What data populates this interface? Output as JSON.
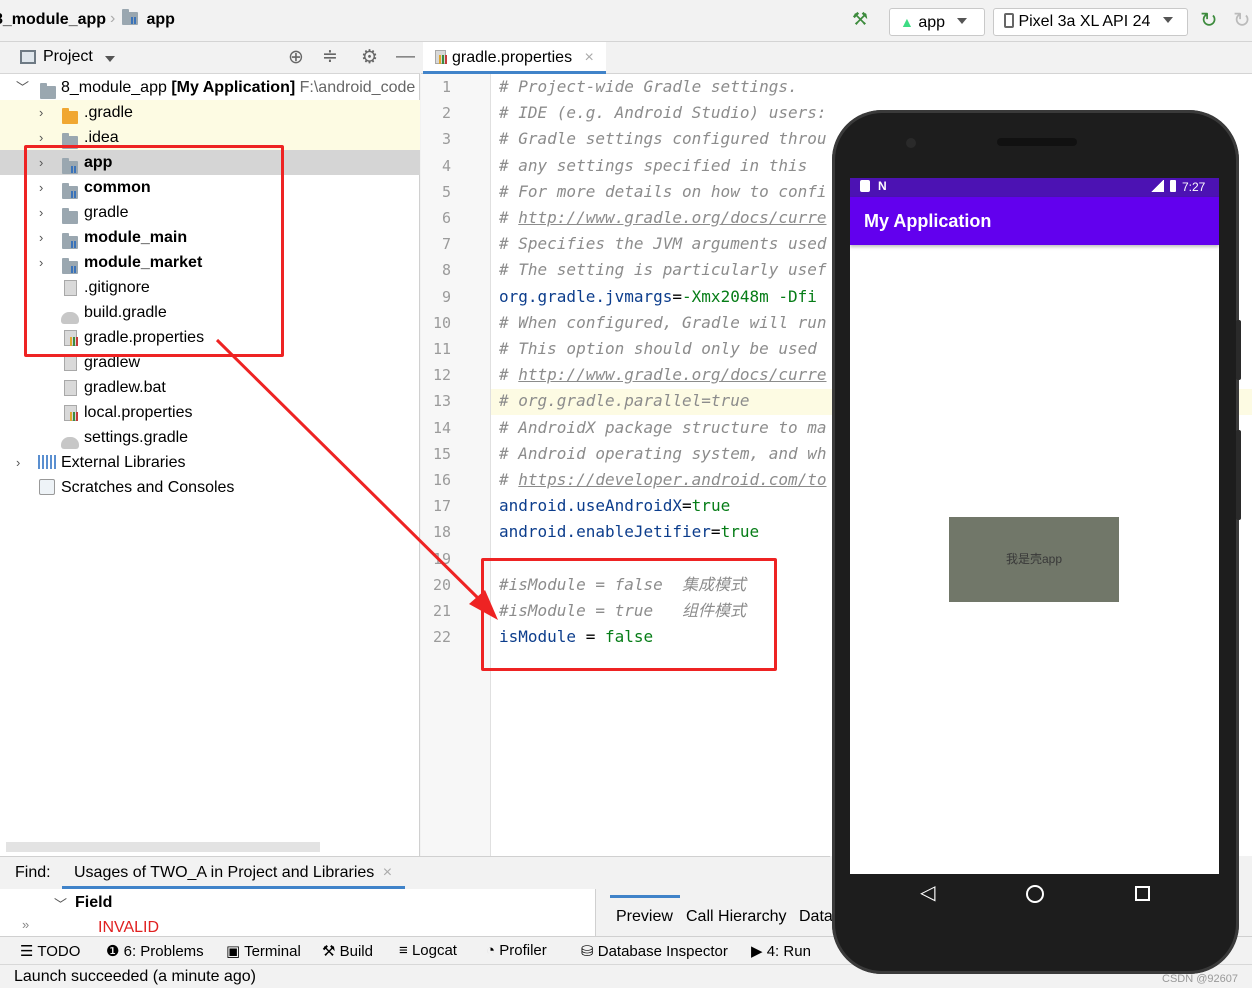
{
  "navbar": {
    "project_crumb": "8_module_app",
    "module_crumb": "app",
    "run_config": "app",
    "device": "Pixel 3a XL API 24"
  },
  "project_panel": {
    "title": "Project",
    "tree": [
      {
        "label": "8_module_app",
        "suffix": "[My Application]",
        "path": "F:\\android_code"
      },
      {
        "label": ".gradle"
      },
      {
        "label": ".idea"
      },
      {
        "label": "app"
      },
      {
        "label": "common"
      },
      {
        "label": "gradle"
      },
      {
        "label": "module_main"
      },
      {
        "label": "module_market"
      },
      {
        "label": ".gitignore"
      },
      {
        "label": "build.gradle"
      },
      {
        "label": "gradle.properties"
      },
      {
        "label": "gradlew"
      },
      {
        "label": "gradlew.bat"
      },
      {
        "label": "local.properties"
      },
      {
        "label": "settings.gradle"
      },
      {
        "label": "External Libraries"
      },
      {
        "label": "Scratches and Consoles"
      }
    ]
  },
  "editor": {
    "tab": "gradle.properties",
    "lines": [
      {
        "n": "1",
        "text": "# Project-wide Gradle settings."
      },
      {
        "n": "2",
        "text": "# IDE (e.g. Android Studio) users:"
      },
      {
        "n": "3",
        "text": "# Gradle settings configured throu"
      },
      {
        "n": "4",
        "text": "# any settings specified in this "
      },
      {
        "n": "5",
        "text": "# For more details on how to confi"
      },
      {
        "n": "6",
        "text": "# ",
        "link": "http://www.gradle.org/docs/curre"
      },
      {
        "n": "7",
        "text": "# Specifies the JVM arguments used"
      },
      {
        "n": "8",
        "text": "# The setting is particularly usef"
      },
      {
        "n": "9",
        "key": "org.gradle.jvmargs",
        "value": "-Xmx2048m -Dfi"
      },
      {
        "n": "10",
        "text": "# When configured, Gradle will run"
      },
      {
        "n": "11",
        "text": "# This option should only be used "
      },
      {
        "n": "12",
        "text": "# ",
        "link": "http://www.gradle.org/docs/curre"
      },
      {
        "n": "13",
        "text": "# org.gradle.parallel=true"
      },
      {
        "n": "14",
        "text": "# AndroidX package structure to ma"
      },
      {
        "n": "15",
        "text": "# Android operating system, and wh"
      },
      {
        "n": "16",
        "text": "# ",
        "link": "https://developer.android.com/to"
      },
      {
        "n": "17",
        "key": "android.useAndroidX",
        "value": "true"
      },
      {
        "n": "18",
        "key": "android.enableJetifier",
        "value": "true"
      },
      {
        "n": "19",
        "text": ""
      },
      {
        "n": "20",
        "text": "#isModule = false  集成模式"
      },
      {
        "n": "21",
        "text": "#isModule = true   组件模式"
      },
      {
        "n": "22",
        "key": "isModule",
        "value": "false",
        "sep": " = "
      }
    ]
  },
  "find_panel": {
    "find_label": "Find:",
    "tab": "Usages of TWO_A in Project and Libraries",
    "tree_root": "Field",
    "invalid": "INVALID",
    "right_tabs": [
      "Preview",
      "Call Hierarchy",
      "Data"
    ]
  },
  "bottom_tabs": [
    {
      "label": "TODO"
    },
    {
      "label": "6: Problems"
    },
    {
      "label": "Terminal"
    },
    {
      "label": "Build"
    },
    {
      "label": "Logcat"
    },
    {
      "label": "Profiler"
    },
    {
      "label": "Database Inspector"
    },
    {
      "label": "4: Run"
    }
  ],
  "status": {
    "message": "Launch succeeded (a minute ago)",
    "watermark": "CSDN @92607"
  },
  "emulator": {
    "time": "7:27",
    "app_title": "My Application",
    "center_text": "我是壳app"
  }
}
